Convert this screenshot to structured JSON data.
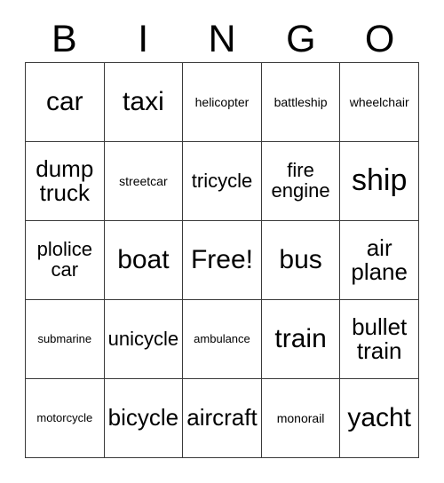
{
  "card": {
    "title": "BINGO",
    "header_letters": [
      "B",
      "I",
      "N",
      "G",
      "O"
    ],
    "free_space_label": "Free!",
    "colors": {
      "background": "#ffffff",
      "text": "#000000",
      "grid_line": "#3a3a3a"
    },
    "rows": [
      [
        {
          "label": "car",
          "size": "lg"
        },
        {
          "label": "taxi",
          "size": "lg"
        },
        {
          "label": "helicopter",
          "size": "xs"
        },
        {
          "label": "battleship",
          "size": "xs"
        },
        {
          "label": "wheelchair",
          "size": "xs"
        }
      ],
      [
        {
          "label": "dump\ntruck",
          "size": "md"
        },
        {
          "label": "streetcar",
          "size": "xs"
        },
        {
          "label": "tricycle",
          "size": "sm"
        },
        {
          "label": "fire\nengine",
          "size": "sm"
        },
        {
          "label": "ship",
          "size": "xl"
        }
      ],
      [
        {
          "label": "plolice\ncar",
          "size": "sm"
        },
        {
          "label": "boat",
          "size": "lg"
        },
        {
          "label": "Free!",
          "size": "lg"
        },
        {
          "label": "bus",
          "size": "lg"
        },
        {
          "label": "air\nplane",
          "size": "md"
        }
      ],
      [
        {
          "label": "submarine",
          "size": "xxs"
        },
        {
          "label": "unicycle",
          "size": "sm"
        },
        {
          "label": "ambulance",
          "size": "xxs"
        },
        {
          "label": "train",
          "size": "lg"
        },
        {
          "label": "bullet\ntrain",
          "size": "md"
        }
      ],
      [
        {
          "label": "motorcycle",
          "size": "xxs"
        },
        {
          "label": "bicycle",
          "size": "md"
        },
        {
          "label": "aircraft",
          "size": "md"
        },
        {
          "label": "monorail",
          "size": "xs"
        },
        {
          "label": "yacht",
          "size": "lg"
        }
      ]
    ]
  }
}
